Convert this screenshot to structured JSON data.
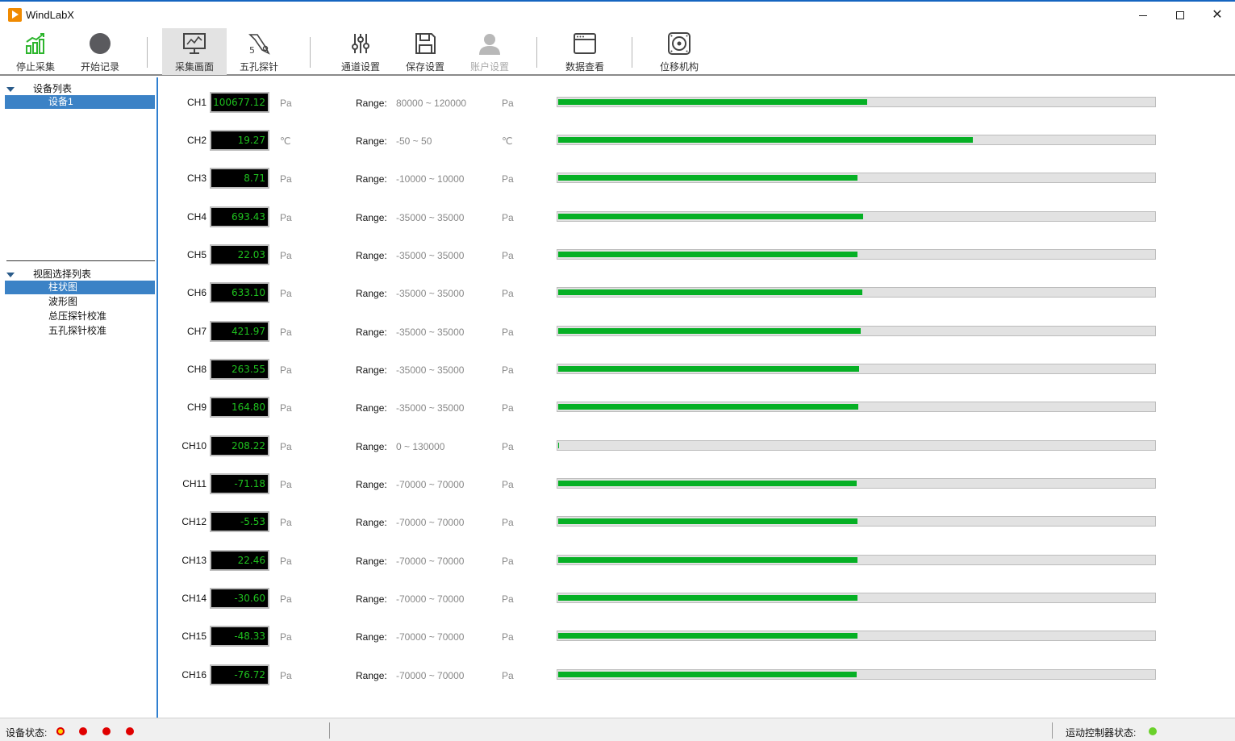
{
  "window": {
    "title": "WindLabX",
    "minimize": "",
    "maximize": "",
    "close": "✕"
  },
  "toolbar": {
    "buttons": [
      {
        "label": "停止采集",
        "icon": "bar-chart-growth-icon"
      },
      {
        "label": "开始记录",
        "icon": "record-circle-icon"
      },
      {
        "label": "采集画面",
        "icon": "monitor-chart-icon",
        "active": true
      },
      {
        "label": "五孔探针",
        "icon": "five-hole-probe-icon"
      },
      {
        "label": "通道设置",
        "icon": "sliders-icon"
      },
      {
        "label": "保存设置",
        "icon": "save-icon"
      },
      {
        "label": "账户设置",
        "icon": "user-icon",
        "disabled": true
      },
      {
        "label": "数据查看",
        "icon": "window-icon"
      },
      {
        "label": "位移机构",
        "icon": "motor-icon"
      }
    ]
  },
  "left_panel": {
    "device_list": {
      "header": "设备列表",
      "items": [
        "设备1"
      ],
      "selected": "设备1"
    },
    "view_list": {
      "header": "视图选择列表",
      "items": [
        "柱状图",
        "波形图",
        "总压探针校准",
        "五孔探针校准"
      ],
      "selected": "柱状图"
    }
  },
  "channels": [
    {
      "name": "CH1",
      "value": "100677.12",
      "unit": "Pa",
      "range_label": "Range:",
      "range": "80000 ~ 120000",
      "range_unit": "Pa",
      "level": 0.517
    },
    {
      "name": "CH2",
      "value": "19.27",
      "unit": "℃",
      "range_label": "Range:",
      "range": "-50 ~ 50",
      "range_unit": "℃",
      "level": 0.693
    },
    {
      "name": "CH3",
      "value": "8.71",
      "unit": "Pa",
      "range_label": "Range:",
      "range": "-10000 ~ 10000",
      "range_unit": "Pa",
      "level": 0.5
    },
    {
      "name": "CH4",
      "value": "693.43",
      "unit": "Pa",
      "range_label": "Range:",
      "range": "-35000 ~ 35000",
      "range_unit": "Pa",
      "level": 0.51
    },
    {
      "name": "CH5",
      "value": "22.03",
      "unit": "Pa",
      "range_label": "Range:",
      "range": "-35000 ~ 35000",
      "range_unit": "Pa",
      "level": 0.5
    },
    {
      "name": "CH6",
      "value": "633.10",
      "unit": "Pa",
      "range_label": "Range:",
      "range": "-35000 ~ 35000",
      "range_unit": "Pa",
      "level": 0.509
    },
    {
      "name": "CH7",
      "value": "421.97",
      "unit": "Pa",
      "range_label": "Range:",
      "range": "-35000 ~ 35000",
      "range_unit": "Pa",
      "level": 0.506
    },
    {
      "name": "CH8",
      "value": "263.55",
      "unit": "Pa",
      "range_label": "Range:",
      "range": "-35000 ~ 35000",
      "range_unit": "Pa",
      "level": 0.504
    },
    {
      "name": "CH9",
      "value": "164.80",
      "unit": "Pa",
      "range_label": "Range:",
      "range": "-35000 ~ 35000",
      "range_unit": "Pa",
      "level": 0.502
    },
    {
      "name": "CH10",
      "value": "208.22",
      "unit": "Pa",
      "range_label": "Range:",
      "range": "0 ~ 130000",
      "range_unit": "Pa",
      "level": 0.002
    },
    {
      "name": "CH11",
      "value": "-71.18",
      "unit": "Pa",
      "range_label": "Range:",
      "range": "-70000 ~ 70000",
      "range_unit": "Pa",
      "level": 0.499
    },
    {
      "name": "CH12",
      "value": "-5.53",
      "unit": "Pa",
      "range_label": "Range:",
      "range": "-70000 ~ 70000",
      "range_unit": "Pa",
      "level": 0.5
    },
    {
      "name": "CH13",
      "value": "22.46",
      "unit": "Pa",
      "range_label": "Range:",
      "range": "-70000 ~ 70000",
      "range_unit": "Pa",
      "level": 0.5
    },
    {
      "name": "CH14",
      "value": "-30.60",
      "unit": "Pa",
      "range_label": "Range:",
      "range": "-70000 ~ 70000",
      "range_unit": "Pa",
      "level": 0.5
    },
    {
      "name": "CH15",
      "value": "-48.33",
      "unit": "Pa",
      "range_label": "Range:",
      "range": "-70000 ~ 70000",
      "range_unit": "Pa",
      "level": 0.5
    },
    {
      "name": "CH16",
      "value": "-76.72",
      "unit": "Pa",
      "range_label": "Range:",
      "range": "-70000 ~ 70000",
      "range_unit": "Pa",
      "level": 0.499
    }
  ],
  "status_bar": {
    "device_status_label": "设备状态:",
    "device_indicators": [
      "warning",
      "error",
      "error",
      "error"
    ],
    "motion_controller_label": "运动控制器状态:",
    "motion_controller_indicator": "ok"
  },
  "colors": {
    "bar_fill": "#06b025",
    "value_text": "#1ec21e",
    "selection": "#3b82c6",
    "status_error": "#e00000",
    "status_ok": "#6ad12a",
    "status_warning": "#ffd400"
  }
}
